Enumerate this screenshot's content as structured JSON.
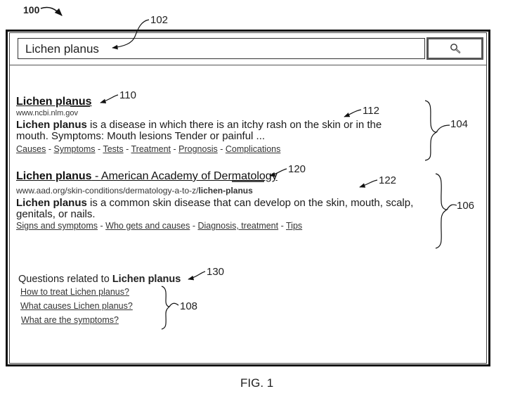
{
  "figure": {
    "ref_main": "100",
    "caption": "FIG. 1"
  },
  "search": {
    "ref": "102",
    "value": "Lichen planus",
    "button_icon": "search-icon"
  },
  "results": [
    {
      "group_ref": "104",
      "title_ref": "110",
      "snippet_ref": "112",
      "title_bold": "Lichen planus",
      "title_rest": "",
      "url_plain": "www.ncbi.nlm.gov",
      "url_bold": "",
      "snippet_bold": "Lichen planus",
      "snippet_rest_line1": " is a disease in which there is an itchy rash on the skin or in the",
      "snippet_line2": "mouth. Symptoms: Mouth lesions Tender or painful ...",
      "links": [
        "Causes",
        "Symptoms",
        "Tests",
        "Treatment",
        "Prognosis",
        "Complications"
      ]
    },
    {
      "group_ref": "106",
      "title_ref": "120",
      "snippet_ref": "122",
      "title_bold": "Lichen planus",
      "title_rest": " - American Academy of Dermatology",
      "url_plain": "www.aad.org/skin-conditions/dermatology-a-to-z/",
      "url_bold": "lichen-planus",
      "snippet_bold": "Lichen planus",
      "snippet_rest_line1": " is a common skin disease that can develop on the skin, mouth, scalp,",
      "snippet_line2": "genitals, or nails.",
      "links": [
        "Signs and symptoms",
        "Who gets and causes",
        "Diagnosis, treatment",
        "Tips"
      ]
    }
  ],
  "questions": {
    "ref_heading": "130",
    "ref_group": "108",
    "heading_prefix": "Questions related to ",
    "heading_bold": "Lichen planus",
    "items": [
      "How to treat Lichen planus?",
      "What causes Lichen planus?",
      "What are the symptoms?"
    ]
  },
  "separator": " - "
}
